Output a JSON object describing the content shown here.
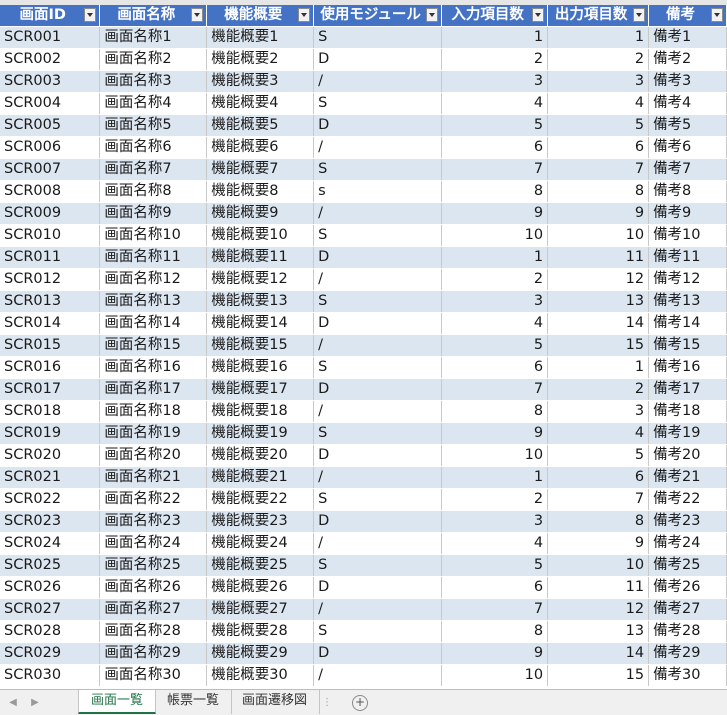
{
  "headers": [
    "画面ID",
    "画面名称",
    "機能概要",
    "使用モジュール",
    "入力項目数",
    "出力項目数",
    "備考"
  ],
  "rows": [
    [
      "SCR001",
      "画面名称1",
      "機能概要1",
      "S",
      "1",
      "1",
      "備考1"
    ],
    [
      "SCR002",
      "画面名称2",
      "機能概要2",
      "D",
      "2",
      "2",
      "備考2"
    ],
    [
      "SCR003",
      "画面名称3",
      "機能概要3",
      "/",
      "3",
      "3",
      "備考3"
    ],
    [
      "SCR004",
      "画面名称4",
      "機能概要4",
      "S",
      "4",
      "4",
      "備考4"
    ],
    [
      "SCR005",
      "画面名称5",
      "機能概要5",
      "D",
      "5",
      "5",
      "備考5"
    ],
    [
      "SCR006",
      "画面名称6",
      "機能概要6",
      "/",
      "6",
      "6",
      "備考6"
    ],
    [
      "SCR007",
      "画面名称7",
      "機能概要7",
      "S",
      "7",
      "7",
      "備考7"
    ],
    [
      "SCR008",
      "画面名称8",
      "機能概要8",
      "s",
      "8",
      "8",
      "備考8"
    ],
    [
      "SCR009",
      "画面名称9",
      "機能概要9",
      "/",
      "9",
      "9",
      "備考9"
    ],
    [
      "SCR010",
      "画面名称10",
      "機能概要10",
      "S",
      "10",
      "10",
      "備考10"
    ],
    [
      "SCR011",
      "画面名称11",
      "機能概要11",
      "D",
      "1",
      "11",
      "備考11"
    ],
    [
      "SCR012",
      "画面名称12",
      "機能概要12",
      "/",
      "2",
      "12",
      "備考12"
    ],
    [
      "SCR013",
      "画面名称13",
      "機能概要13",
      "S",
      "3",
      "13",
      "備考13"
    ],
    [
      "SCR014",
      "画面名称14",
      "機能概要14",
      "D",
      "4",
      "14",
      "備考14"
    ],
    [
      "SCR015",
      "画面名称15",
      "機能概要15",
      "/",
      "5",
      "15",
      "備考15"
    ],
    [
      "SCR016",
      "画面名称16",
      "機能概要16",
      "S",
      "6",
      "1",
      "備考16"
    ],
    [
      "SCR017",
      "画面名称17",
      "機能概要17",
      "D",
      "7",
      "2",
      "備考17"
    ],
    [
      "SCR018",
      "画面名称18",
      "機能概要18",
      "/",
      "8",
      "3",
      "備考18"
    ],
    [
      "SCR019",
      "画面名称19",
      "機能概要19",
      "S",
      "9",
      "4",
      "備考19"
    ],
    [
      "SCR020",
      "画面名称20",
      "機能概要20",
      "D",
      "10",
      "5",
      "備考20"
    ],
    [
      "SCR021",
      "画面名称21",
      "機能概要21",
      "/",
      "1",
      "6",
      "備考21"
    ],
    [
      "SCR022",
      "画面名称22",
      "機能概要22",
      "S",
      "2",
      "7",
      "備考22"
    ],
    [
      "SCR023",
      "画面名称23",
      "機能概要23",
      "D",
      "3",
      "8",
      "備考23"
    ],
    [
      "SCR024",
      "画面名称24",
      "機能概要24",
      "/",
      "4",
      "9",
      "備考24"
    ],
    [
      "SCR025",
      "画面名称25",
      "機能概要25",
      "S",
      "5",
      "10",
      "備考25"
    ],
    [
      "SCR026",
      "画面名称26",
      "機能概要26",
      "D",
      "6",
      "11",
      "備考26"
    ],
    [
      "SCR027",
      "画面名称27",
      "機能概要27",
      "/",
      "7",
      "12",
      "備考27"
    ],
    [
      "SCR028",
      "画面名称28",
      "機能概要28",
      "S",
      "8",
      "13",
      "備考28"
    ],
    [
      "SCR029",
      "画面名称29",
      "機能概要29",
      "D",
      "9",
      "14",
      "備考29"
    ],
    [
      "SCR030",
      "画面名称30",
      "機能概要30",
      "/",
      "10",
      "15",
      "備考30"
    ]
  ],
  "numeric_columns": [
    4,
    5
  ],
  "sheet_tabs": [
    "画面一覧",
    "帳票一覧",
    "画面遷移図"
  ],
  "active_sheet": "画面一覧",
  "add_sheet_label": "+",
  "icons": {
    "filter": "filter-dropdown-icon",
    "nav_prev": "triangle-left-icon",
    "nav_next": "triangle-right-icon",
    "add": "plus-circle-icon"
  },
  "colors": {
    "header_bg": "#4472c4",
    "band_bg": "#dce6f1",
    "active_tab": "#217346"
  }
}
